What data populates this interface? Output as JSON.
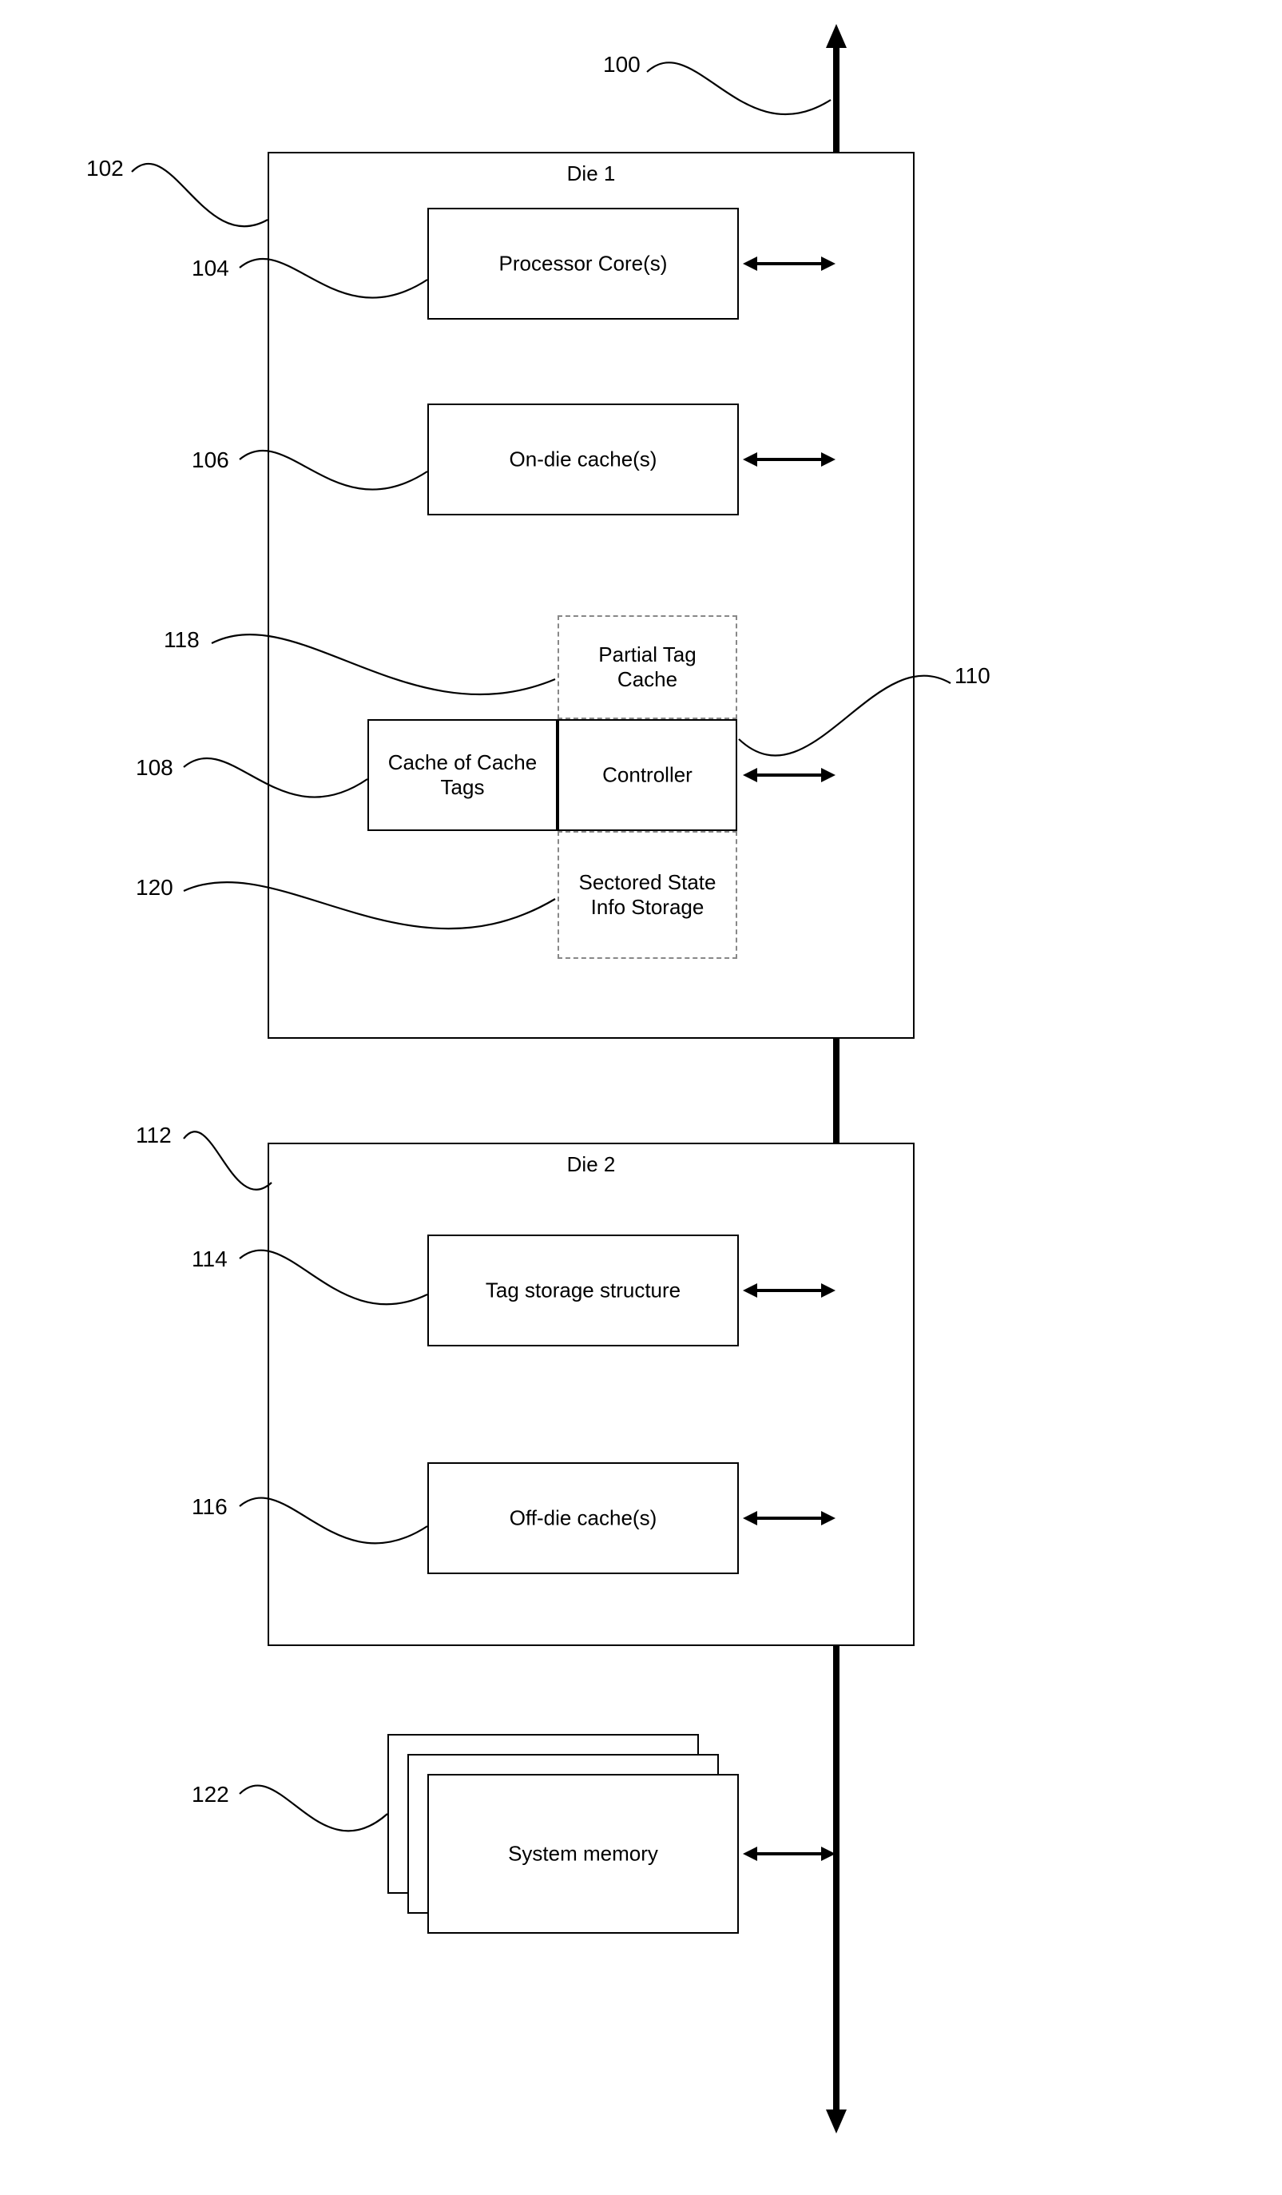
{
  "refs": {
    "r100": "100",
    "r102": "102",
    "r104": "104",
    "r106": "106",
    "r108": "108",
    "r110": "110",
    "r112": "112",
    "r114": "114",
    "r116": "116",
    "r118": "118",
    "r120": "120",
    "r122": "122"
  },
  "die1": {
    "title": "Die 1",
    "processor": "Processor Core(s)",
    "ondie": "On-die cache(s)",
    "partial": "Partial Tag Cache",
    "cct": "Cache of Cache Tags",
    "controller": "Controller",
    "sectored": "Sectored State Info Storage"
  },
  "die2": {
    "title": "Die 2",
    "tagstorage": "Tag storage structure",
    "offdie": "Off-die cache(s)"
  },
  "sysmem": "System memory"
}
